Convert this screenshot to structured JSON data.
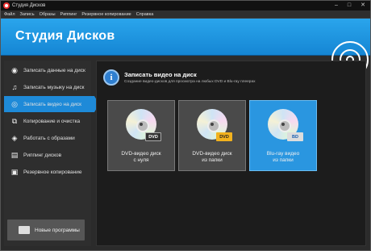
{
  "window": {
    "title": "Студия Дисков",
    "controls": {
      "minimize": "–",
      "maximize": "□",
      "close": "✕"
    }
  },
  "menu": [
    "Файл",
    "Запись",
    "Образы",
    "Риппинг",
    "Резервное копирование",
    "Справка"
  ],
  "banner": {
    "title": "Студия Дисков",
    "logo_icon": "disc-logo-icon"
  },
  "sidebar": {
    "items": [
      {
        "label": "Записать данные на диск",
        "icon": "disc-icon"
      },
      {
        "label": "Записать музыку на диск",
        "icon": "music-note-icon"
      },
      {
        "label": "Записать видео на диск",
        "icon": "video-disc-icon",
        "active": true
      },
      {
        "label": "Копирование и очистка",
        "icon": "copy-icon"
      },
      {
        "label": "Работать с образами",
        "icon": "image-icon"
      },
      {
        "label": "Риппинг дисков",
        "icon": "rip-icon"
      },
      {
        "label": "Резервное копирование",
        "icon": "backup-icon"
      }
    ],
    "new_programs": "Новые программы"
  },
  "content": {
    "title": "Записать видео на диск",
    "subtitle": "Создание видео-дисков для просмотра на любых DVD и Blu-ray плеерах",
    "cards": [
      {
        "line1": "DVD-видео диск",
        "line2": "с нуля",
        "badge": "DVD"
      },
      {
        "line1": "DVD-видео диск",
        "line2": "из папки",
        "badge": "DVD"
      },
      {
        "line1": "Blu-ray видео",
        "line2": "из папки",
        "badge": "BD",
        "selected": true
      }
    ]
  },
  "colors": {
    "accent": "#1e8ad8",
    "banner": "#2aa5ec",
    "background": "#2b2b2b"
  }
}
